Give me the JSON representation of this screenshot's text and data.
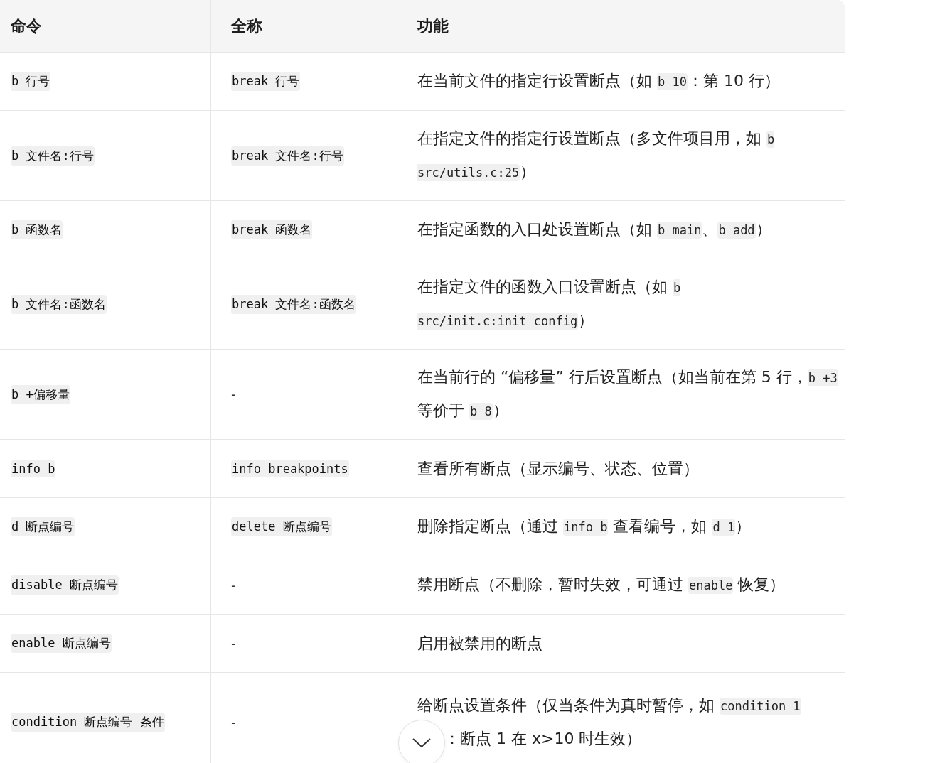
{
  "table": {
    "columns": [
      "命令",
      "全称",
      "功能"
    ],
    "rows": [
      {
        "command": "b 行号",
        "full": {
          "kind": "code",
          "text": "break 行号"
        },
        "description": [
          {
            "kind": "text",
            "text": "在当前文件的指定行设置断点（如 "
          },
          {
            "kind": "code",
            "text": "b 10"
          },
          {
            "kind": "text",
            "text": "：第 10 行）"
          }
        ]
      },
      {
        "command": "b 文件名:行号",
        "full": {
          "kind": "code",
          "text": "break 文件名:行号"
        },
        "description": [
          {
            "kind": "text",
            "text": "在指定文件的指定行设置断点（多文件项目用，如 "
          },
          {
            "kind": "code",
            "text": "b src/utils.c:25"
          },
          {
            "kind": "text",
            "text": "）"
          }
        ]
      },
      {
        "command": "b 函数名",
        "full": {
          "kind": "code",
          "text": "break 函数名"
        },
        "description": [
          {
            "kind": "text",
            "text": "在指定函数的入口处设置断点（如 "
          },
          {
            "kind": "code",
            "text": "b main"
          },
          {
            "kind": "text",
            "text": "、"
          },
          {
            "kind": "code",
            "text": "b add"
          },
          {
            "kind": "text",
            "text": "）"
          }
        ]
      },
      {
        "command": "b 文件名:函数名",
        "full": {
          "kind": "code",
          "text": "break 文件名:函数名"
        },
        "description": [
          {
            "kind": "text",
            "text": "在指定文件的函数入口设置断点（如 "
          },
          {
            "kind": "code",
            "text": "b src/init.c:init_config"
          },
          {
            "kind": "text",
            "text": "）"
          }
        ]
      },
      {
        "command": "b +偏移量",
        "full": {
          "kind": "text",
          "text": "-"
        },
        "description": [
          {
            "kind": "text",
            "text": "在当前行的 “偏移量” 行后设置断点（如当前在第 5 行，"
          },
          {
            "kind": "code",
            "text": "b +3"
          },
          {
            "kind": "text",
            "text": " 等价于 "
          },
          {
            "kind": "code",
            "text": "b 8"
          },
          {
            "kind": "text",
            "text": "）"
          }
        ]
      },
      {
        "command": "info b",
        "full": {
          "kind": "code",
          "text": "info breakpoints"
        },
        "description": [
          {
            "kind": "text",
            "text": "查看所有断点（显示编号、状态、位置）"
          }
        ]
      },
      {
        "command": "d 断点编号",
        "full": {
          "kind": "code",
          "text": "delete 断点编号"
        },
        "description": [
          {
            "kind": "text",
            "text": "删除指定断点（通过 "
          },
          {
            "kind": "code",
            "text": "info b"
          },
          {
            "kind": "text",
            "text": " 查看编号，如 "
          },
          {
            "kind": "code",
            "text": "d 1"
          },
          {
            "kind": "text",
            "text": "）"
          }
        ]
      },
      {
        "command": "disable 断点编号",
        "full": {
          "kind": "text",
          "text": "-"
        },
        "description": [
          {
            "kind": "text",
            "text": "禁用断点（不删除，暂时失效，可通过 "
          },
          {
            "kind": "code",
            "text": "enable"
          },
          {
            "kind": "text",
            "text": " 恢复）"
          }
        ]
      },
      {
        "command": "enable 断点编号",
        "full": {
          "kind": "text",
          "text": "-"
        },
        "description": [
          {
            "kind": "text",
            "text": "启用被禁用的断点"
          }
        ]
      },
      {
        "command": "condition 断点编号 条件",
        "full": {
          "kind": "text",
          "text": "-"
        },
        "description": [
          {
            "kind": "text",
            "text": "给断点设置条件（仅当条件为真时暂停，如 "
          },
          {
            "kind": "code",
            "text": "condition 1"
          },
          {
            "kind": "covered"
          },
          {
            "kind": "text",
            "text": "：断点 1 在 x>10 时生效）"
          }
        ]
      }
    ]
  },
  "scroll_button": {
    "kind": "down"
  }
}
